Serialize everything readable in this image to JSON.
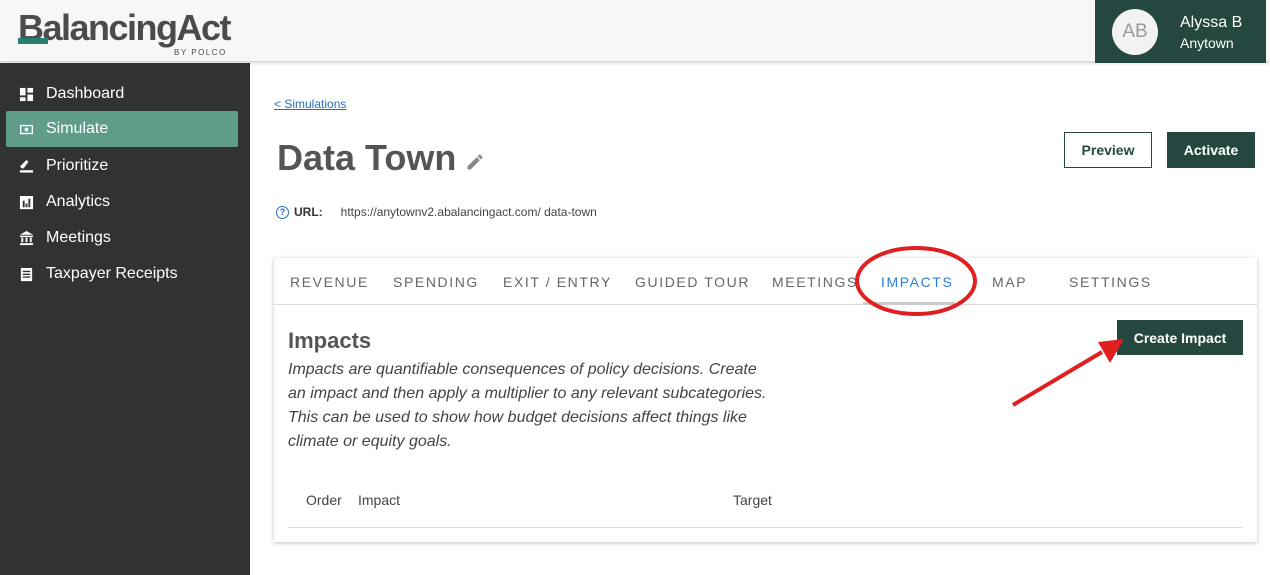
{
  "header": {
    "logo_main": "BalancingAct",
    "logo_b": "B",
    "logo_rest": "alancingAct",
    "logo_sub": "BY POLCO",
    "avatar_initials": "AB",
    "user_name": "Alyssa B",
    "user_town": "Anytown"
  },
  "sidebar": {
    "items": [
      {
        "label": "Dashboard",
        "icon": "dashboard-icon",
        "active": false
      },
      {
        "label": "Simulate",
        "icon": "money-icon",
        "active": true
      },
      {
        "label": "Prioritize",
        "icon": "scale-icon",
        "active": false
      },
      {
        "label": "Analytics",
        "icon": "chart-icon",
        "active": false
      },
      {
        "label": "Meetings",
        "icon": "building-icon",
        "active": false
      },
      {
        "label": "Taxpayer Receipts",
        "icon": "receipt-icon",
        "active": false
      }
    ]
  },
  "main": {
    "back_link": "< Simulations",
    "title": "Data Town",
    "preview_label": "Preview",
    "activate_label": "Activate",
    "url_label": "URL:",
    "url_value": "https://anytownv2.abalancingact.com/ data-town"
  },
  "tabs": [
    {
      "label": "REVENUE",
      "active": false
    },
    {
      "label": "SPENDING",
      "active": false
    },
    {
      "label": "EXIT / ENTRY",
      "active": false
    },
    {
      "label": "GUIDED TOUR",
      "active": false
    },
    {
      "label": "MEETINGS",
      "active": false
    },
    {
      "label": "IMPACTS",
      "active": true
    },
    {
      "label": "MAP",
      "active": false
    },
    {
      "label": "SETTINGS",
      "active": false
    }
  ],
  "impacts": {
    "heading": "Impacts",
    "description": "Impacts are quantifiable consequences of policy decisions. Create an impact and then apply a multiplier to any relevant subcategories. This can be used to show how budget decisions affect things like climate or equity goals.",
    "create_label": "Create Impact",
    "columns": [
      "Order",
      "Impact",
      "Target"
    ]
  },
  "colors": {
    "brand_dark": "#24483f",
    "brand_active": "#5f9d8a",
    "sidebar_bg": "#313330",
    "link": "#2a6fb4",
    "annotation": "#e02020"
  }
}
